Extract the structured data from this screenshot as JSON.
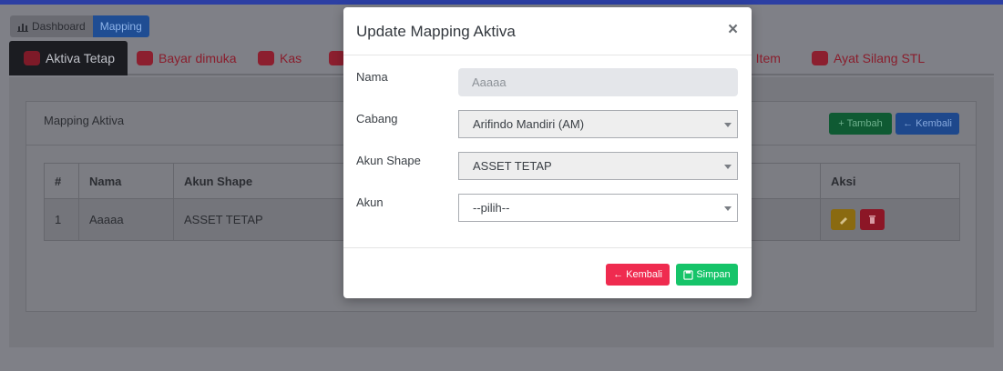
{
  "breadcrumb": {
    "home": "Dashboard",
    "current": "Mapping"
  },
  "tabs": [
    {
      "label": "Aktiva Tetap",
      "icon": "chart-icon",
      "active": true
    },
    {
      "label": "Bayar dimuka",
      "icon": "folder-icon",
      "active": false
    },
    {
      "label": "Kas",
      "icon": "network-icon",
      "active": false
    },
    {
      "label": "",
      "icon": "chart-icon",
      "active": false
    },
    {
      "label": "ri Item",
      "icon": "",
      "active": false
    },
    {
      "label": "Ayat Silang STL",
      "icon": "folder-icon",
      "active": false
    }
  ],
  "card": {
    "title": "Mapping Aktiva",
    "buttons": {
      "tambah": "+ Tambah",
      "kembali": "← Kembali"
    }
  },
  "table": {
    "headers": [
      "#",
      "Nama",
      "Akun Shape",
      "",
      "Aksi"
    ],
    "rows": [
      {
        "no": "1",
        "nama": "Aaaaa",
        "akun_shape": "ASSET TETAP",
        "akun": ""
      }
    ]
  },
  "modal": {
    "title": "Update Mapping Aktiva",
    "close": "×",
    "fields": {
      "nama": {
        "label": "Nama",
        "value": "Aaaaa"
      },
      "cabang": {
        "label": "Cabang",
        "value": "Arifindo Mandiri (AM)"
      },
      "akun_shape": {
        "label": "Akun Shape",
        "value": "ASSET TETAP"
      },
      "akun": {
        "label": "Akun",
        "value": "--pilih--"
      }
    },
    "buttons": {
      "kembali": "← Kembali",
      "simpan": "Simpan"
    }
  },
  "colors": {
    "primary": "#2c3fa3",
    "danger": "#ef2b4f",
    "success": "#16c469",
    "warning": "#8a6a10"
  }
}
